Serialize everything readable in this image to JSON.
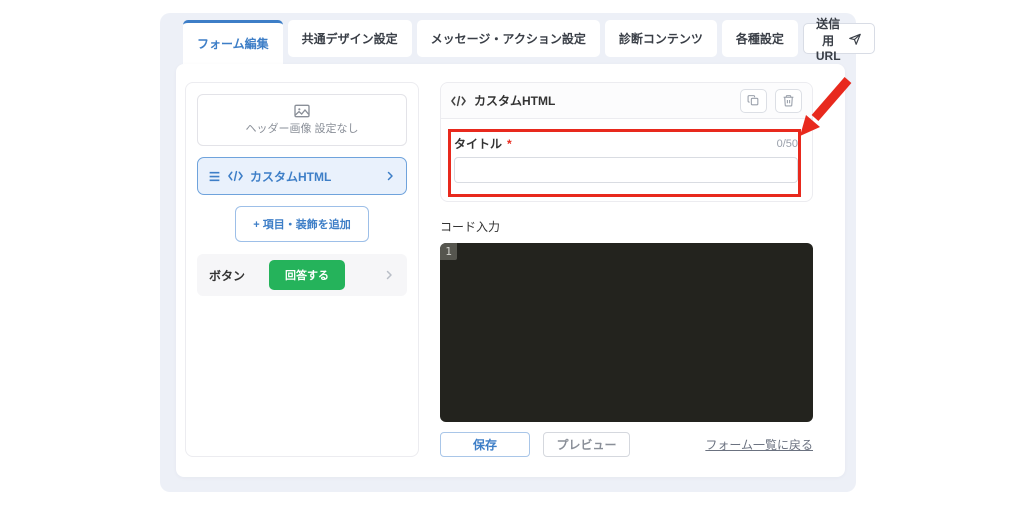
{
  "tabs": [
    {
      "label": "フォーム編集",
      "active": true
    },
    {
      "label": "共通デザイン設定",
      "active": false
    },
    {
      "label": "メッセージ・アクション設定",
      "active": false
    },
    {
      "label": "診断コンテンツ",
      "active": false
    },
    {
      "label": "各種設定",
      "active": false
    }
  ],
  "send_url_button": {
    "label": "送信用URL"
  },
  "sidebar": {
    "header_image": {
      "label": "ヘッダー画像 設定なし"
    },
    "custom_html_item": {
      "label": "カスタムHTML"
    },
    "add_button": {
      "label": "+ 項目・装飾を追加"
    },
    "button_row": {
      "label": "ボタン",
      "button_label": "回答する"
    }
  },
  "panel": {
    "title": "カスタムHTML",
    "field": {
      "label": "タイトル",
      "required_mark": "*",
      "counter": "0/50",
      "value": ""
    },
    "code_label": "コード入力",
    "code_line_number": "1"
  },
  "actions": {
    "save": "保存",
    "preview": "プレビュー",
    "back_link": "フォーム一覧に戻る"
  },
  "colors": {
    "accent_blue": "#3d7ec7",
    "green": "#25b35b",
    "annotation_red": "#e8291d",
    "editor_bg": "#23231e",
    "app_bg": "#edf0f7"
  }
}
